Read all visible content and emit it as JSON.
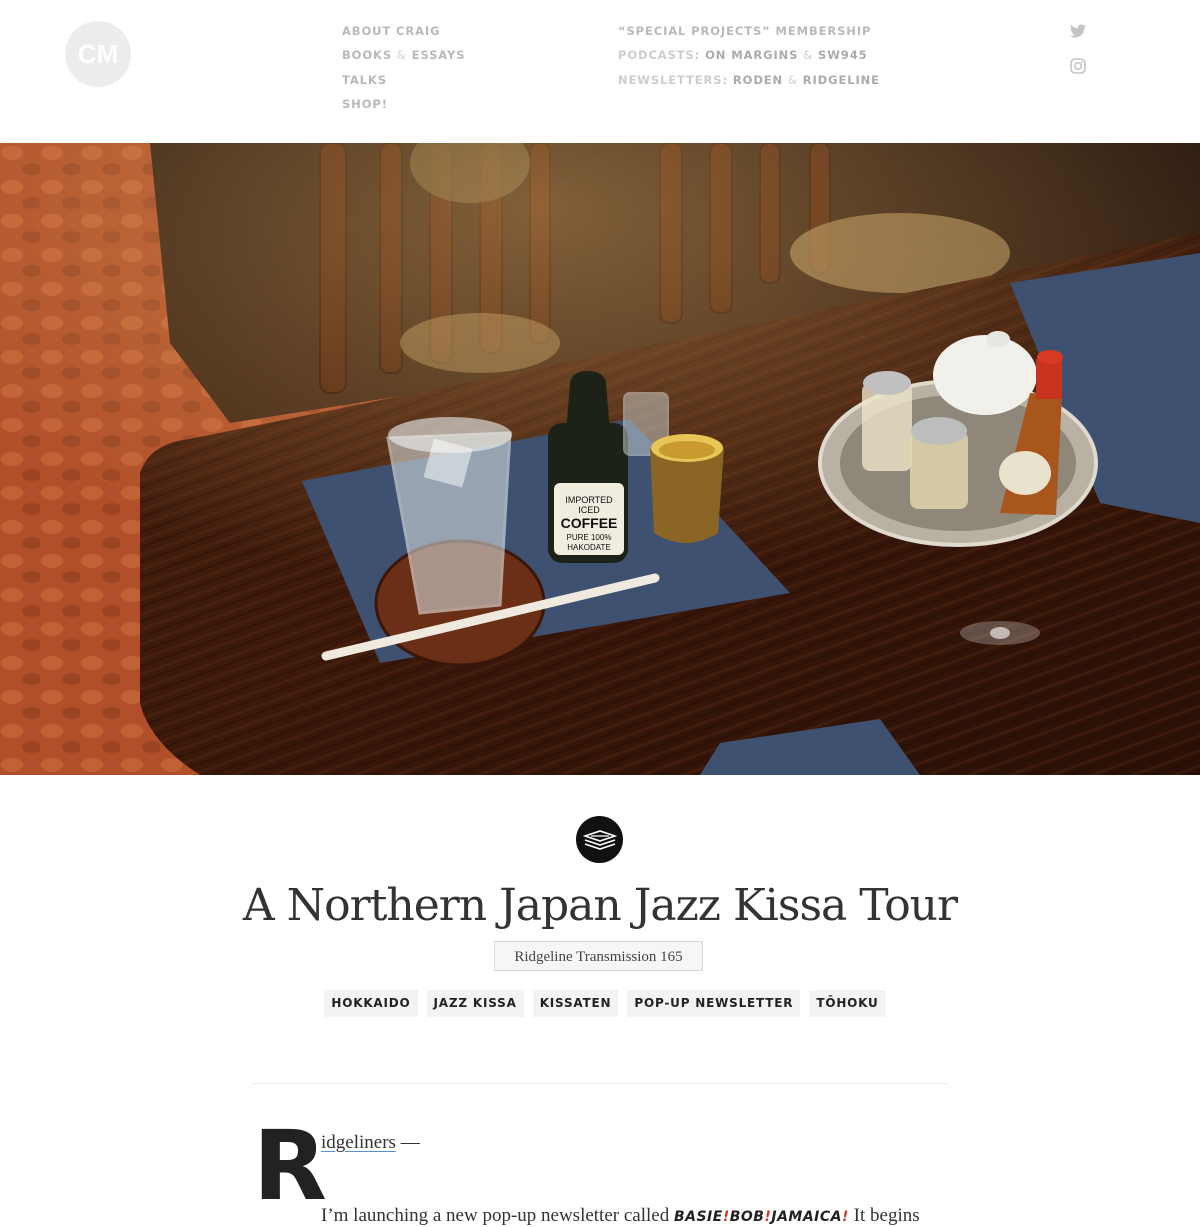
{
  "header": {
    "logo_text": "CM",
    "nav_left": [
      {
        "label": "About Craig"
      },
      {
        "label": "Books",
        "amp": "&",
        "label2": "Essays"
      },
      {
        "label": "Talks"
      },
      {
        "label": "Shop!"
      }
    ],
    "nav_right": {
      "membership": "“Special Projects” Membership",
      "podcasts_prefix": "Podcasts:",
      "podcast_1": "On Margins",
      "podcast_amp": "&",
      "podcast_2": "SW945",
      "newsletters_prefix": "Newsletters:",
      "newsletter_1": "Roden",
      "newsletter_amp": "&",
      "newsletter_2": "Ridgeline"
    },
    "social_icons": [
      "twitter-icon",
      "instagram-icon"
    ]
  },
  "hero": {
    "bottle_label_lines": [
      "IMPORTED",
      "ICED",
      "COFFEE",
      "PURE 100%",
      "HAKODATE"
    ],
    "colors": {
      "wood": "#3a1a0c",
      "placemat": "#3f5170",
      "carpet": "#b5542c"
    }
  },
  "article": {
    "badge_icon": "stack-icon",
    "title": "A Northern Japan Jazz Kissa Tour",
    "subtitle": "Ridgeline Transmission 165",
    "tags": [
      "HOKKAIDO",
      "JAZZ KISSA",
      "KISSATEN",
      "POP-UP NEWSLETTER",
      "TŌHOKU"
    ],
    "dropcap": "R",
    "greeting_link": "idgeliners",
    "greeting_rest": " —",
    "para_start": "I’m launching a new pop-up newsletter called ",
    "newsletter_name_a": "BASIE",
    "newsletter_name_sep1": "!",
    "newsletter_name_b": "BOB",
    "newsletter_name_sep2": "!",
    "newsletter_name_c": "JAMAICA",
    "newsletter_name_sep3": "!",
    "para_end": " It begins"
  }
}
